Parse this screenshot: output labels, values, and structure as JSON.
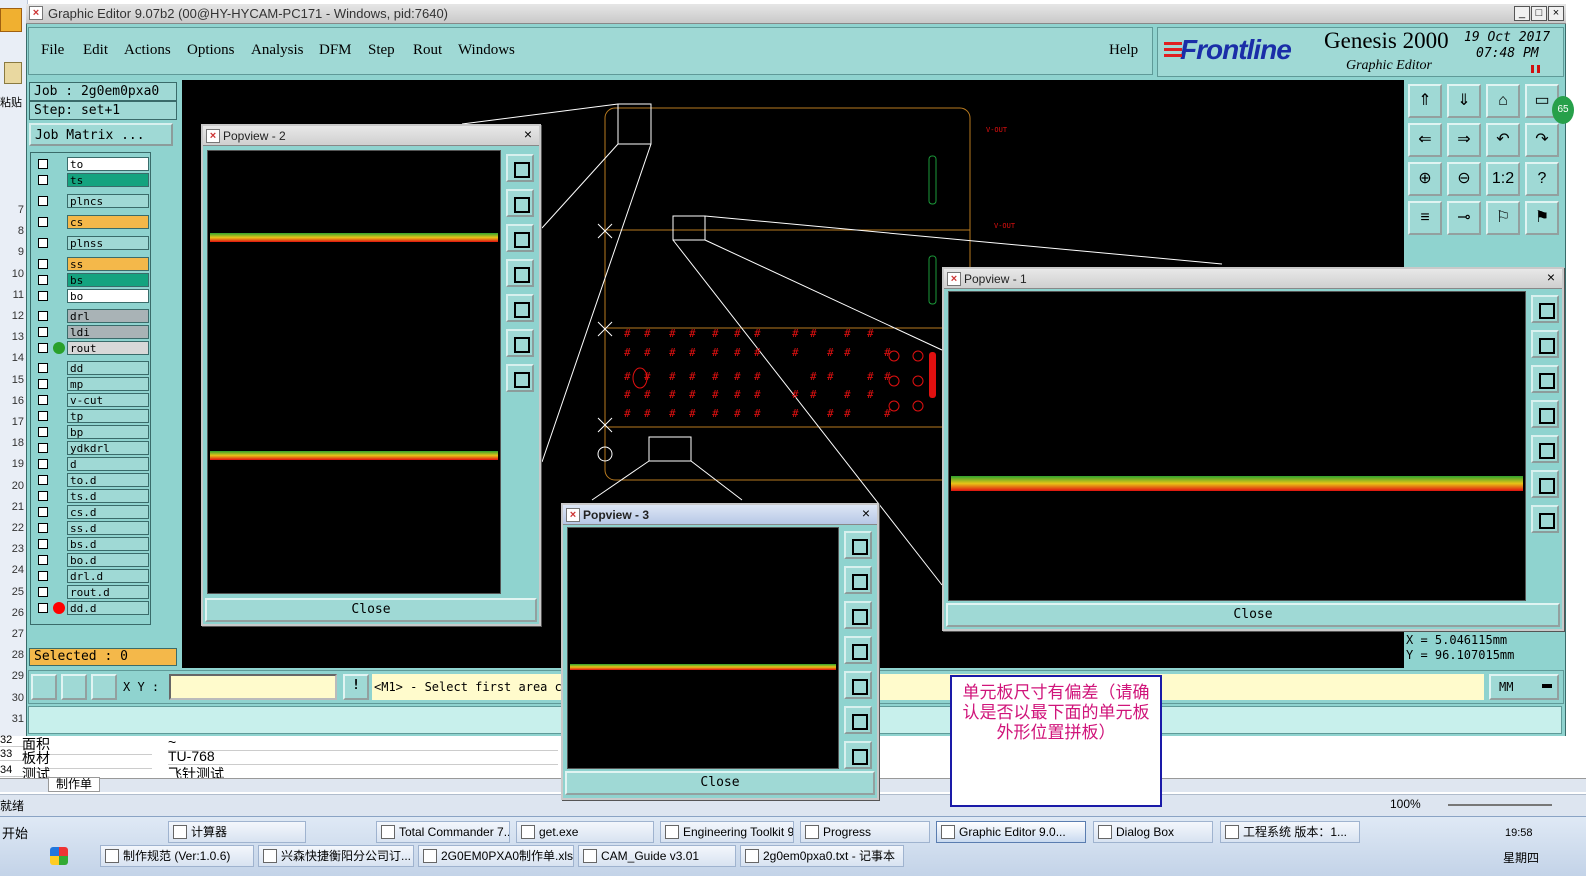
{
  "window": {
    "title": "Graphic Editor 9.07b2 (00@HY-HYCAM-PC171 - Windows, pid:7640)",
    "min": "_",
    "max": "□",
    "close": "×"
  },
  "menu": [
    "File",
    "Edit",
    "Actions",
    "Options",
    "Analysis",
    "DFM",
    "Step",
    "Rout",
    "Windows"
  ],
  "help": "Help",
  "brand": {
    "logo": "Frontline",
    "product": "Genesis 2000",
    "subtitle": "Graphic Editor",
    "date": "19 Oct 2017",
    "time": "07:48 PM"
  },
  "job": {
    "job_label": "Job : 2g0em0pxa0",
    "step_label": "Step: set+1",
    "matrix_button": "Job Matrix ...",
    "selected": "Selected : 0"
  },
  "layers": [
    {
      "name": "to",
      "color": "#ffffff",
      "dot": ""
    },
    {
      "name": "ts",
      "color": "#14a37f",
      "dot": ""
    },
    {
      "name": "plncs",
      "color": "#9fd9d5",
      "dot": ""
    },
    {
      "name": "cs",
      "color": "#f4b84a",
      "dot": ""
    },
    {
      "name": "plnss",
      "color": "#9fd9d5",
      "dot": ""
    },
    {
      "name": "ss",
      "color": "#f4b84a",
      "dot": ""
    },
    {
      "name": "bs",
      "color": "#14a37f",
      "dot": ""
    },
    {
      "name": "bo",
      "color": "#ffffff",
      "dot": ""
    },
    {
      "name": "drl",
      "color": "#a9b3b6",
      "dot": ""
    },
    {
      "name": "ldi",
      "color": "#a9b3b6",
      "dot": ""
    },
    {
      "name": "rout",
      "color": "#d8d8d8",
      "dot": "#2aa02a"
    },
    {
      "name": "dd",
      "color": "#9fd9d5",
      "dot": ""
    },
    {
      "name": "mp",
      "color": "#9fd9d5",
      "dot": ""
    },
    {
      "name": "v-cut",
      "color": "#9fd9d5",
      "dot": ""
    },
    {
      "name": "tp",
      "color": "#9fd9d5",
      "dot": ""
    },
    {
      "name": "bp",
      "color": "#9fd9d5",
      "dot": ""
    },
    {
      "name": "ydkdrl",
      "color": "#9fd9d5",
      "dot": ""
    },
    {
      "name": "d",
      "color": "#9fd9d5",
      "dot": ""
    },
    {
      "name": "to.d",
      "color": "#9fd9d5",
      "dot": ""
    },
    {
      "name": "ts.d",
      "color": "#9fd9d5",
      "dot": ""
    },
    {
      "name": "cs.d",
      "color": "#9fd9d5",
      "dot": ""
    },
    {
      "name": "ss.d",
      "color": "#9fd9d5",
      "dot": ""
    },
    {
      "name": "bs.d",
      "color": "#9fd9d5",
      "dot": ""
    },
    {
      "name": "bo.d",
      "color": "#9fd9d5",
      "dot": ""
    },
    {
      "name": "drl.d",
      "color": "#9fd9d5",
      "dot": ""
    },
    {
      "name": "rout.d",
      "color": "#9fd9d5",
      "dot": ""
    },
    {
      "name": "dd.d",
      "color": "#9fd9d5",
      "dot": "#ff0000"
    }
  ],
  "popviews": {
    "p1": {
      "title": "Popview - 1",
      "close": "Close"
    },
    "p2": {
      "title": "Popview - 2",
      "close": "Close"
    },
    "p3": {
      "title": "Popview - 3",
      "close": "Close"
    }
  },
  "canvas_labels": {
    "vcut1": "V-OUT",
    "vcut2": "V-OUT"
  },
  "coords": {
    "x": "X = 5.046115mm",
    "y": "Y = 96.107015mm"
  },
  "command": {
    "xy_label": "X Y :",
    "xy_value": "",
    "prompt": "<M1> - Select first area co",
    "units": "MM",
    "bang": "!"
  },
  "note": "单元板尺寸有偏差（请确认是否以最下面的单元板外形位置拼板）",
  "excel": {
    "rows": [
      {
        "num": "32",
        "label": "面积",
        "value": "~"
      },
      {
        "num": "33",
        "label": "板材",
        "value": "TU-768"
      },
      {
        "num": "34",
        "label": "测试",
        "value": "飞针测试"
      }
    ],
    "row_numbers": [
      "7",
      "8",
      "9",
      "10",
      "11",
      "12",
      "13",
      "14",
      "15",
      "16",
      "17",
      "18",
      "19",
      "20",
      "21",
      "22",
      "23",
      "24",
      "25",
      "26",
      "27",
      "28",
      "29",
      "30",
      "31"
    ],
    "sheet_tab": "制作单",
    "status": "就绪",
    "zoom": "100%",
    "paste": "粘贴"
  },
  "taskbar": {
    "start": "开始",
    "row1": [
      {
        "label": "计算器",
        "active": false
      },
      {
        "label": "Total Commander 7....",
        "active": false
      },
      {
        "label": "get.exe",
        "active": false
      },
      {
        "label": "Engineering Toolkit 9....",
        "active": false
      },
      {
        "label": "Progress",
        "active": false
      },
      {
        "label": "Graphic Editor 9.0...",
        "active": true
      },
      {
        "label": "Dialog Box",
        "active": false
      },
      {
        "label": "工程系统   版本：1...",
        "active": false
      }
    ],
    "row2": [
      {
        "label": "制作规范 (Ver:1.0.6)",
        "active": false
      },
      {
        "label": "兴森快捷衡阳分公司订...",
        "active": false
      },
      {
        "label": "2G0EM0PXA0制作单.xls ...",
        "active": false
      },
      {
        "label": "CAM_Guide v3.01",
        "active": false
      },
      {
        "label": "2g0em0pxa0.txt - 记事本",
        "active": false
      }
    ],
    "clock": "19:58",
    "weekday": "星期四"
  },
  "badge": "65"
}
